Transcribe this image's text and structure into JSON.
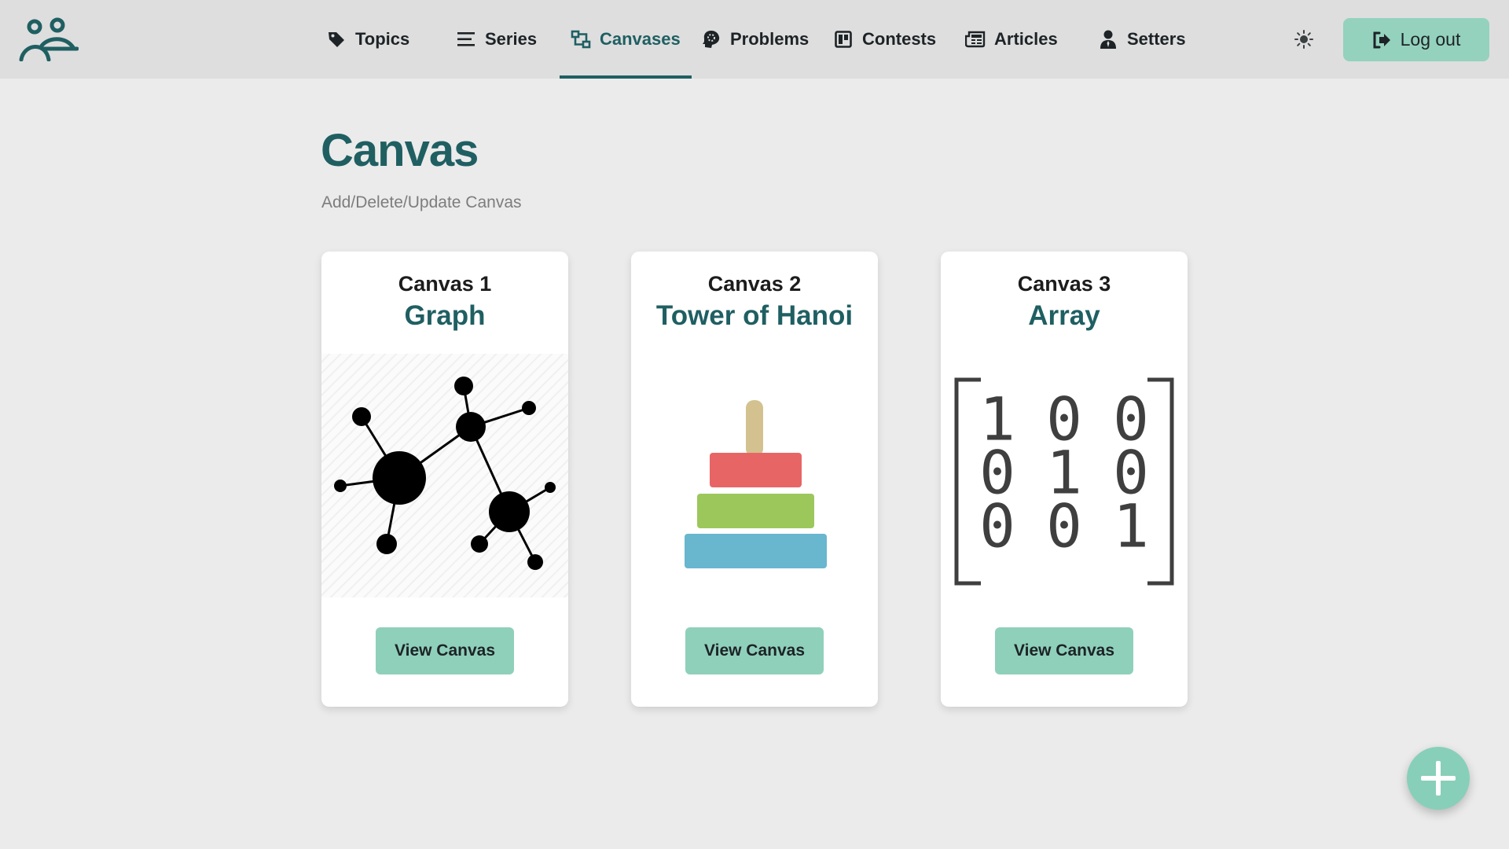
{
  "nav": {
    "logo_icon": "users-logo-icon",
    "items": [
      {
        "label": "Topics",
        "icon": "tag-icon"
      },
      {
        "label": "Series",
        "icon": "list-icon"
      },
      {
        "label": "Canvases",
        "icon": "canvas-icon",
        "active": true
      },
      {
        "label": "Problems",
        "icon": "brain-icon"
      },
      {
        "label": "Contests",
        "icon": "board-icon"
      },
      {
        "label": "Articles",
        "icon": "newspaper-icon"
      },
      {
        "label": "Setters",
        "icon": "user-tie-icon"
      }
    ],
    "theme_icon": "sun-icon",
    "logout_label": "Log out",
    "logout_icon": "sign-out-icon"
  },
  "page": {
    "title": "Canvas",
    "subtitle": "Add/Delete/Update Canvas"
  },
  "cards": [
    {
      "number": "Canvas 1",
      "name": "Graph",
      "image": "graph-illustration",
      "button": "View Canvas"
    },
    {
      "number": "Canvas 2",
      "name": "Tower of Hanoi",
      "image": "tower-of-hanoi-illustration",
      "button": "View Canvas"
    },
    {
      "number": "Canvas 3",
      "name": "Array",
      "image": "identity-matrix-illustration",
      "matrix": [
        [
          "1",
          "0",
          "0"
        ],
        [
          "0",
          "1",
          "0"
        ],
        [
          "0",
          "0",
          "1"
        ]
      ],
      "button": "View Canvas"
    }
  ],
  "fab": {
    "icon": "plus-icon"
  },
  "colors": {
    "accent": "#1f5f62",
    "button": "#8fd0bb",
    "navbar": "#dedede",
    "background": "#ebebeb",
    "hanoi_peg": "#d3c28f",
    "hanoi_disk_small": "#e86565",
    "hanoi_disk_medium": "#9cc75b",
    "hanoi_disk_large": "#69b6cf"
  }
}
